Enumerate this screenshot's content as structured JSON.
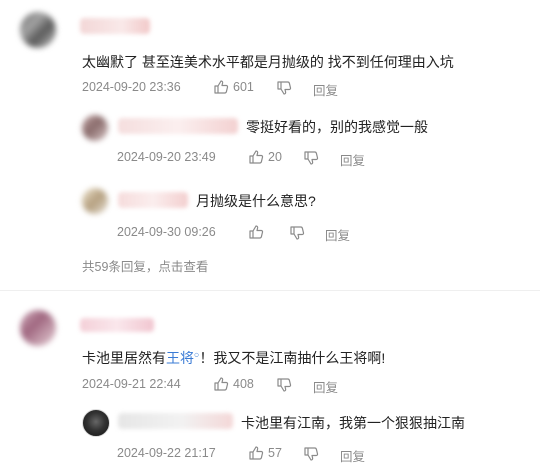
{
  "comments": [
    {
      "text": "太幽默了 甚至连美术水平都是月抛级的 找不到任何理由入坑",
      "date": "2024-09-20 23:36",
      "likes": "601",
      "reply_label": "回复",
      "replies": [
        {
          "text": "零挺好看的，别的我感觉一般",
          "date": "2024-09-20 23:49",
          "likes": "20",
          "reply_label": "回复"
        },
        {
          "text": "月抛级是什么意思?",
          "date": "2024-09-30 09:26",
          "likes": "",
          "reply_label": "回复"
        }
      ],
      "more_replies": "共59条回复，点击查看"
    },
    {
      "text_before": "卡池里居然有",
      "link": "王将",
      "text_after": "！我又不是江南抽什么王将啊!",
      "date": "2024-09-21 22:44",
      "likes": "408",
      "reply_label": "回复",
      "replies": [
        {
          "text": "卡池里有江南，我第一个狠狠抽江南",
          "date": "2024-09-22 21:17",
          "likes": "57",
          "reply_label": "回复"
        }
      ]
    }
  ],
  "icons": {
    "like": "thumb-up-icon",
    "dislike": "thumb-down-icon",
    "search_badge": "search-icon"
  }
}
